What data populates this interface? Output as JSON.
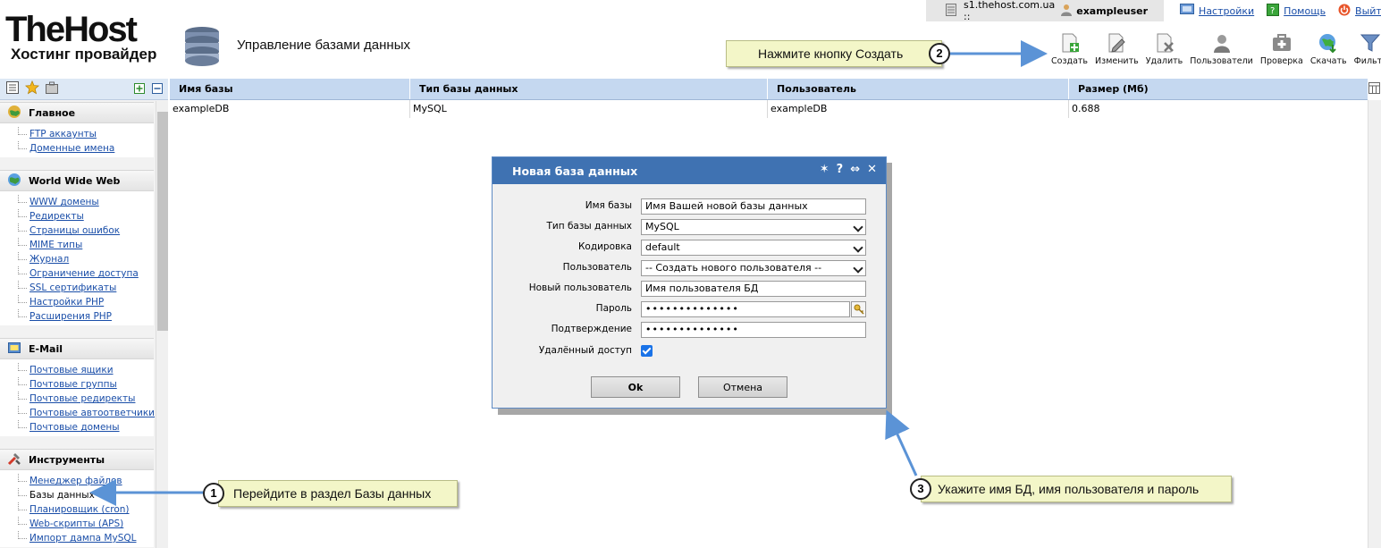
{
  "header": {
    "logo_main": "TheHost",
    "logo_sub": "Хостинг провайдер",
    "page_title": "Управление базами данных",
    "server": "s1.thehost.com.ua ::",
    "user": "exampleuser",
    "links": {
      "settings": "Настройки",
      "help": "Помощь",
      "logout": "Выйти"
    }
  },
  "toolbar": {
    "create": "Создать",
    "edit": "Изменить",
    "delete": "Удалить",
    "users": "Пользователи",
    "check": "Проверка",
    "download": "Скачать",
    "filter": "Фильтр"
  },
  "sidebar": {
    "groups": [
      {
        "title": "Главное",
        "items": [
          "FTP аккаунты",
          "Доменные имена"
        ]
      },
      {
        "title": "World Wide Web",
        "items": [
          "WWW домены",
          "Редиректы",
          "Страницы ошибок",
          "MIME типы",
          "Журнал",
          "Ограничение доступа",
          "SSL сертификаты",
          "Настройки PHP",
          "Расширения PHP"
        ]
      },
      {
        "title": "E-Mail",
        "items": [
          "Почтовые ящики",
          "Почтовые группы",
          "Почтовые редиректы",
          "Почтовые автоответчики",
          "Почтовые домены"
        ]
      },
      {
        "title": "Инструменты",
        "items": [
          "Менеджер файлов",
          "Базы данных",
          "Планировщик (cron)",
          "Web-скрипты (APS)",
          "Импорт дампа MySQL"
        ]
      }
    ]
  },
  "table": {
    "columns": [
      "Имя базы",
      "Тип базы данных",
      "Пользователь",
      "Размер (Мб)"
    ],
    "rows": [
      [
        "exampleDB",
        "MySQL",
        "exampleDB",
        "0.688"
      ]
    ]
  },
  "dialog": {
    "title": "Новая база данных",
    "fields": {
      "db_name": {
        "label": "Имя базы",
        "value": "Имя Вашей новой базы данных"
      },
      "db_type": {
        "label": "Тип базы данных",
        "value": "MySQL"
      },
      "encoding": {
        "label": "Кодировка",
        "value": "default"
      },
      "user": {
        "label": "Пользователь",
        "value": "-- Создать нового пользователя --"
      },
      "new_user": {
        "label": "Новый пользователь",
        "value": "Имя пользователя БД"
      },
      "password": {
        "label": "Пароль",
        "value": "••••••••••••••"
      },
      "confirm": {
        "label": "Подтверждение",
        "value": "••••••••••••••"
      },
      "remote": {
        "label": "Удалённый доступ",
        "checked": true
      }
    },
    "ok": "Ok",
    "cancel": "Отмена"
  },
  "callouts": [
    {
      "num": "1",
      "text": "Перейдите в раздел Базы данных"
    },
    {
      "num": "2",
      "text": "Нажмите кнопку Создать"
    },
    {
      "num": "3",
      "text": "Укажите имя БД, имя пользователя и пароль"
    }
  ],
  "colors": {
    "table_header": "#c5d8f0",
    "dialog_header": "#3f72b2",
    "link": "#1a4ea8",
    "callout_bg": "#f3f6c8",
    "arrow": "#5b93d6"
  }
}
